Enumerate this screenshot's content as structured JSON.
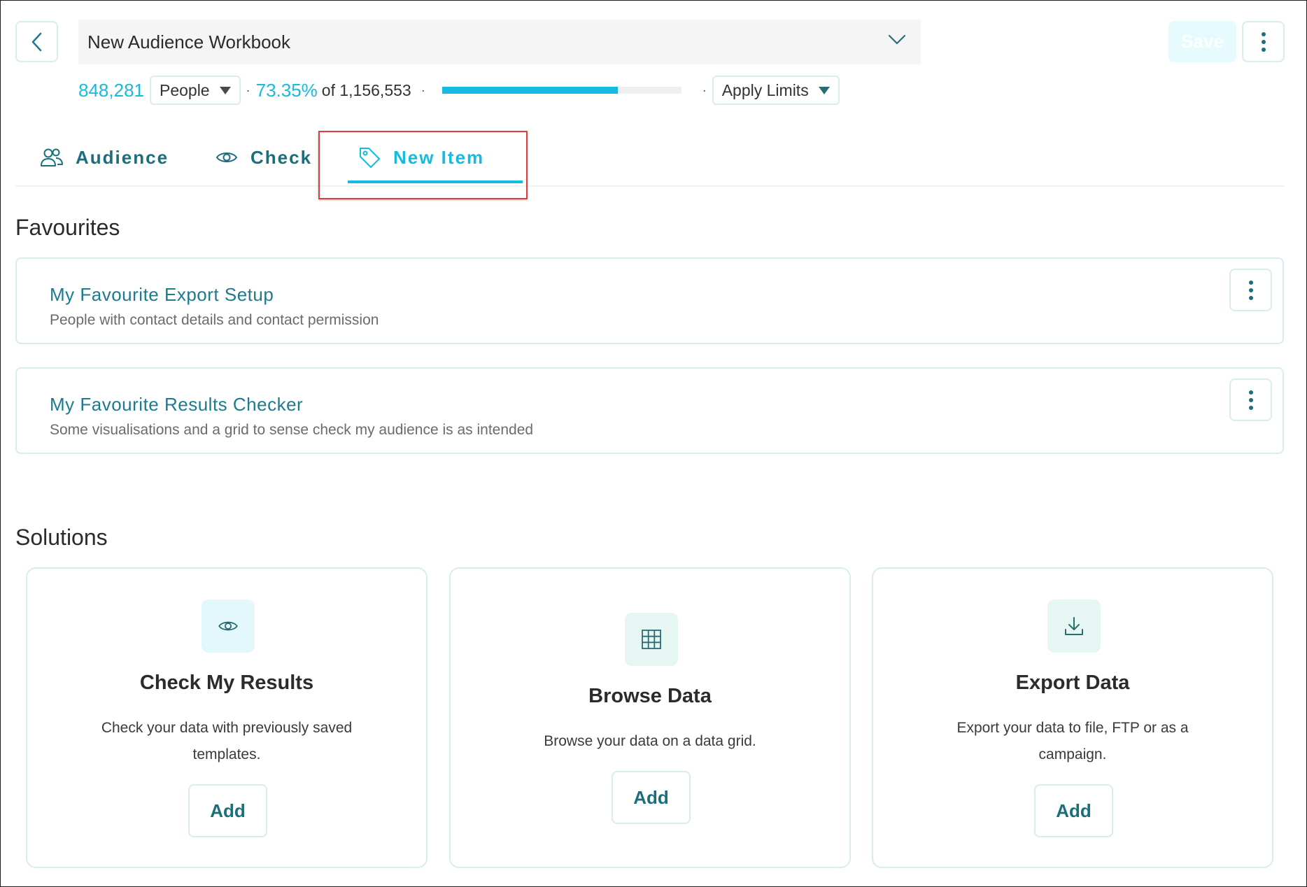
{
  "header": {
    "back_icon": "chevron-left-icon",
    "workbook_title": "New Audience Workbook",
    "save_label": "Save",
    "more_icon": "kebab-icon"
  },
  "stats": {
    "count": "848,281",
    "unit_select": "People",
    "percent": "73.35%",
    "of_total": "of 1,156,553",
    "progress_fraction": 0.7335,
    "apply_limits": "Apply Limits"
  },
  "tabs": [
    {
      "label": "Audience",
      "icon": "people-icon",
      "active": false
    },
    {
      "label": "Check",
      "icon": "eye-icon",
      "active": false
    },
    {
      "label": "New Item",
      "icon": "tag-icon",
      "active": true
    }
  ],
  "favourites": {
    "title": "Favourites",
    "items": [
      {
        "title": "My Favourite Export Setup",
        "description": "People with contact details and contact permission"
      },
      {
        "title": "My Favourite Results Checker",
        "description": "Some visualisations and a grid to sense check my audience is as intended"
      }
    ]
  },
  "solutions": {
    "title": "Solutions",
    "items": [
      {
        "name": "Check My Results",
        "description": "Check your data with previously saved templates.",
        "icon": "eye-icon",
        "button": "Add"
      },
      {
        "name": "Browse Data",
        "description": "Browse your data on a data grid.",
        "icon": "grid-icon",
        "button": "Add"
      },
      {
        "name": "Export Data",
        "description": "Export your data to file, FTP or as a campaign.",
        "icon": "download-icon",
        "button": "Add"
      }
    ]
  },
  "colors": {
    "accent": "#15bbe0",
    "teal_text": "#1c6e7d",
    "border": "#d9ecef",
    "highlight": "#e23b3b"
  }
}
